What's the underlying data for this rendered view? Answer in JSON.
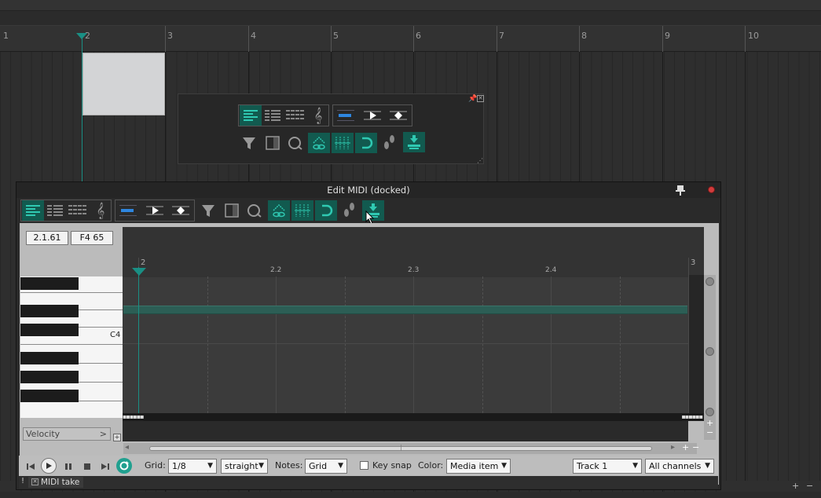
{
  "arrange": {
    "ruler_marks": [
      "1",
      "2",
      "3",
      "4",
      "5",
      "6",
      "7",
      "8",
      "9",
      "10"
    ]
  },
  "midi_editor": {
    "title": "Edit MIDI (docked)",
    "position": "2.1.61",
    "note": "F4  65",
    "ruler_labels": [
      "2",
      "2.2",
      "2.3",
      "2.4",
      "3"
    ],
    "key_label": "C4",
    "cc_lane": "Velocity",
    "cc_lane_arrow": ">",
    "grid_label": "Grid:",
    "grid_value": "1/8",
    "grid_type": "straight",
    "notes_label": "Notes:",
    "notes_value": "Grid",
    "key_snap_label": "Key snap",
    "color_label": "Color:",
    "color_value": "Media item",
    "track_value": "Track 1",
    "channel_value": "All channels",
    "take_tab": "MIDI take",
    "cc_plus": "+"
  },
  "colors": {
    "accent": "#1a8f84",
    "active_button": "#125a4f",
    "note": "#2c5e55",
    "close": "#d23c3c"
  },
  "icons": [
    "list-view-icon",
    "grid-view-icon",
    "drum-view-icon",
    "treble-clef-icon",
    "piano-roll-icon",
    "play-icon",
    "diamond-icon",
    "filter-icon",
    "inline-editor-icon",
    "quantize-icon",
    "link-icon",
    "grid-lines-icon",
    "snap-icon",
    "footsteps-icon",
    "insert-icon",
    "pin-icon",
    "close-icon"
  ]
}
